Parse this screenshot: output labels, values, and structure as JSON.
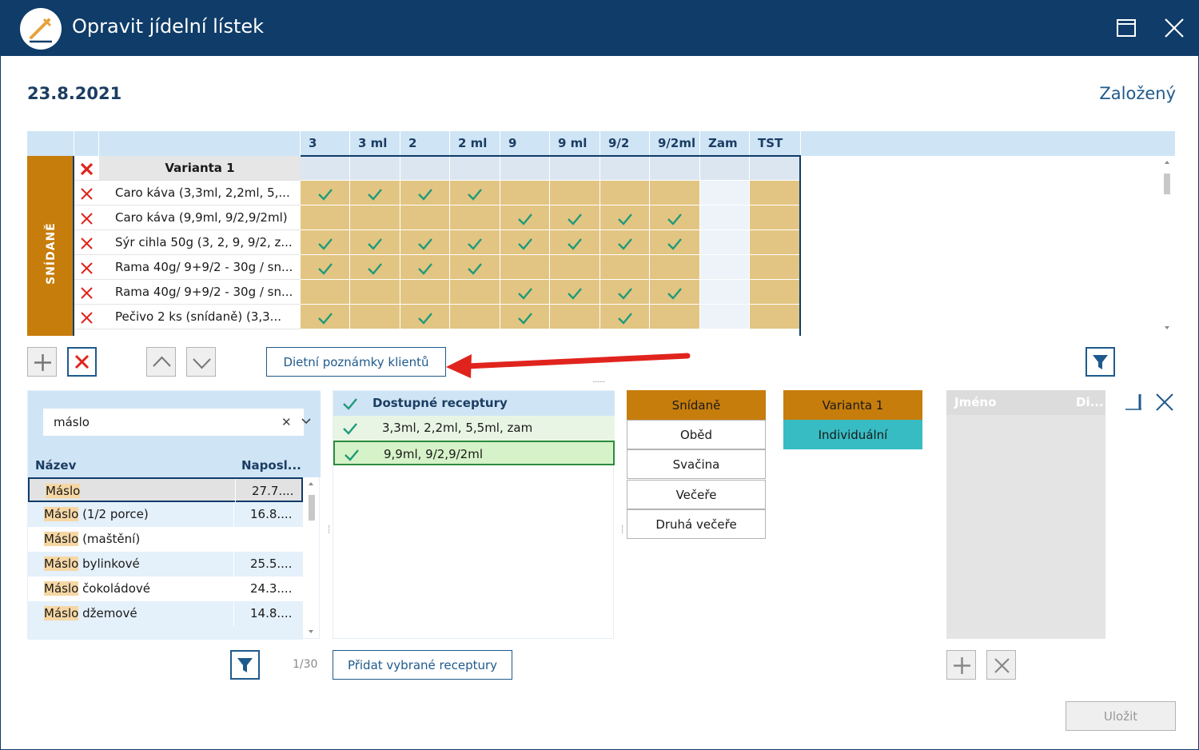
{
  "window": {
    "title": "Opravit jídelní lístek"
  },
  "header": {
    "date": "23.8.2021",
    "status": "Založený"
  },
  "grid": {
    "meal": "SNÍDANĚ",
    "columns": [
      "3",
      "3 ml",
      "2",
      "2 ml",
      "9",
      "9 ml",
      "9/2",
      "9/2ml",
      "Zam",
      "TST"
    ],
    "variant_label": "Varianta 1",
    "rows": [
      {
        "name": "Caro káva (3,3ml,  2,2ml, 5,...",
        "checks": [
          true,
          true,
          true,
          true,
          false,
          false,
          false,
          false,
          false,
          false
        ]
      },
      {
        "name": "Caro káva (9,9ml, 9/2,9/2ml)",
        "checks": [
          false,
          false,
          false,
          false,
          true,
          true,
          true,
          true,
          false,
          false
        ]
      },
      {
        "name": "Sýr cihla  50g (3, 2, 9, 9/2, z...",
        "checks": [
          true,
          true,
          true,
          true,
          true,
          true,
          true,
          true,
          false,
          false
        ]
      },
      {
        "name": "Rama  40g/ 9+9/2 - 30g / sn...",
        "checks": [
          true,
          true,
          true,
          true,
          false,
          false,
          false,
          false,
          false,
          false
        ]
      },
      {
        "name": "Rama  40g/ 9+9/2 - 30g / sn...",
        "checks": [
          false,
          false,
          false,
          false,
          true,
          true,
          true,
          true,
          false,
          false
        ]
      },
      {
        "name": "Pečivo 2 ks  (snídaně) (3,3...",
        "checks": [
          true,
          false,
          true,
          false,
          true,
          false,
          true,
          false,
          false,
          false
        ]
      }
    ]
  },
  "toolbar": {
    "diet_notes_label": "Dietní poznámky klientů"
  },
  "search": {
    "value": "máslo",
    "col_name": "Název",
    "col_last": "Naposl...",
    "items": [
      {
        "highlight": "Máslo",
        "rest": "",
        "date": "27.7...."
      },
      {
        "highlight": "Máslo",
        "rest": " (1/2 porce)",
        "date": "16.8...."
      },
      {
        "highlight": "Máslo",
        "rest": " (maštění)",
        "date": ""
      },
      {
        "highlight": "Máslo",
        "rest": " bylinkové",
        "date": "25.5...."
      },
      {
        "highlight": "Máslo",
        "rest": " čokoládové",
        "date": "24.3...."
      },
      {
        "highlight": "Máslo",
        "rest": " džemové",
        "date": "14.8...."
      }
    ],
    "page_count": "1/30"
  },
  "recipes": {
    "header": "Dostupné receptury",
    "items": [
      "3,3ml,  2,2ml, 5,5ml, zam",
      "9,9ml,  9/2,9/2ml"
    ],
    "add_label": "Přidat vybrané receptury"
  },
  "meals": [
    "Snídaně",
    "Oběd",
    "Svačina",
    "Večeře",
    "Druhá večeře"
  ],
  "variants": [
    "Varianta 1",
    "Individuální"
  ],
  "clients": {
    "col_name": "Jméno",
    "col_diet": "Di..."
  },
  "save_label": "Uložit",
  "colors": {
    "navy": "#0f3c68",
    "header_blue": "#cfe5f6",
    "orange": "#c77d0b",
    "cell_tan": "#e2c582",
    "teal": "#37bcc3",
    "check_green": "#1f9a7a",
    "red": "#e0241d"
  }
}
